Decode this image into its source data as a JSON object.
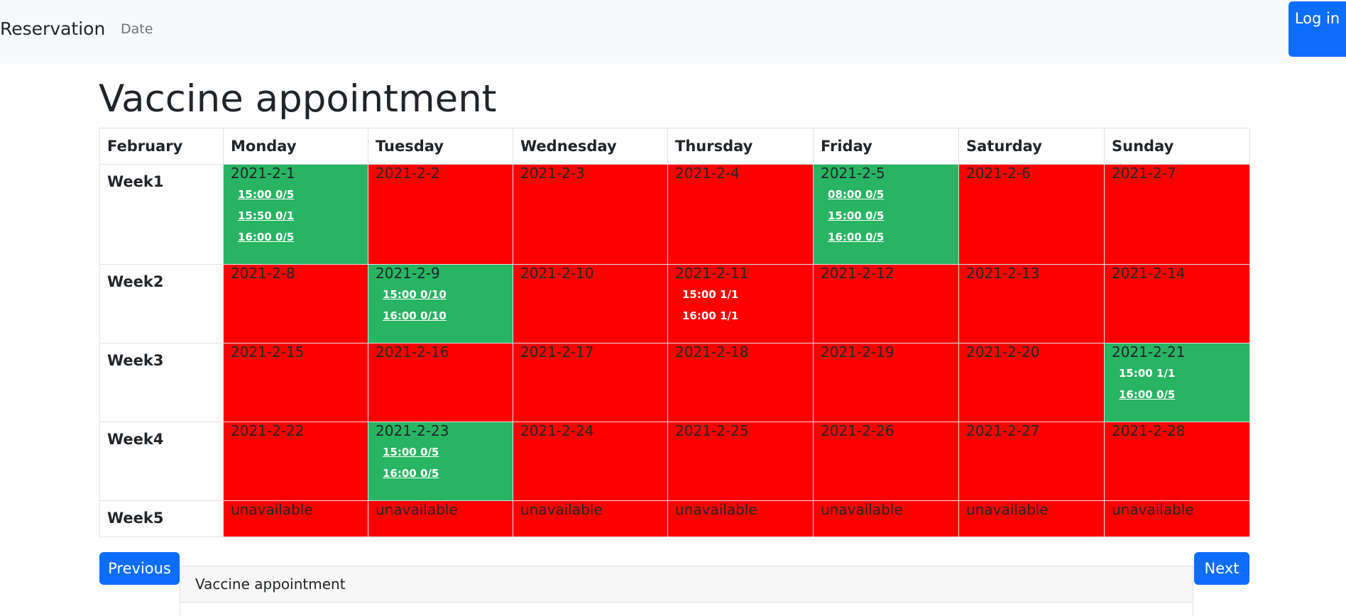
{
  "navbar": {
    "brand": "Reservation",
    "date_link": "Date",
    "login_button": "Log in"
  },
  "page": {
    "title": "Vaccine appointment"
  },
  "calendar": {
    "month": "February",
    "days": [
      "Monday",
      "Tuesday",
      "Wednesday",
      "Thursday",
      "Friday",
      "Saturday",
      "Sunday"
    ],
    "weeks": [
      {
        "label": "Week1",
        "cells": [
          {
            "date": "2021-2-1",
            "status": "available",
            "slots": [
              {
                "text": "15:00 0/5",
                "link": true
              },
              {
                "text": "15:50 0/1",
                "link": true
              },
              {
                "text": "16:00 0/5",
                "link": true
              }
            ]
          },
          {
            "date": "2021-2-2",
            "status": "unavailable",
            "slots": []
          },
          {
            "date": "2021-2-3",
            "status": "unavailable",
            "slots": []
          },
          {
            "date": "2021-2-4",
            "status": "unavailable",
            "slots": []
          },
          {
            "date": "2021-2-5",
            "status": "available",
            "slots": [
              {
                "text": "08:00 0/5",
                "link": true
              },
              {
                "text": "15:00 0/5",
                "link": true
              },
              {
                "text": "16:00 0/5",
                "link": true
              }
            ]
          },
          {
            "date": "2021-2-6",
            "status": "unavailable",
            "slots": []
          },
          {
            "date": "2021-2-7",
            "status": "unavailable",
            "slots": []
          }
        ]
      },
      {
        "label": "Week2",
        "cells": [
          {
            "date": "2021-2-8",
            "status": "unavailable",
            "slots": []
          },
          {
            "date": "2021-2-9",
            "status": "available",
            "slots": [
              {
                "text": "15:00 0/10",
                "link": true
              },
              {
                "text": "16:00 0/10",
                "link": true
              }
            ]
          },
          {
            "date": "2021-2-10",
            "status": "unavailable",
            "slots": []
          },
          {
            "date": "2021-2-11",
            "status": "unavailable",
            "slots": [
              {
                "text": "15:00 1/1",
                "link": false
              },
              {
                "text": "16:00 1/1",
                "link": false
              }
            ]
          },
          {
            "date": "2021-2-12",
            "status": "unavailable",
            "slots": []
          },
          {
            "date": "2021-2-13",
            "status": "unavailable",
            "slots": []
          },
          {
            "date": "2021-2-14",
            "status": "unavailable",
            "slots": []
          }
        ]
      },
      {
        "label": "Week3",
        "cells": [
          {
            "date": "2021-2-15",
            "status": "unavailable",
            "slots": []
          },
          {
            "date": "2021-2-16",
            "status": "unavailable",
            "slots": []
          },
          {
            "date": "2021-2-17",
            "status": "unavailable",
            "slots": []
          },
          {
            "date": "2021-2-18",
            "status": "unavailable",
            "slots": []
          },
          {
            "date": "2021-2-19",
            "status": "unavailable",
            "slots": []
          },
          {
            "date": "2021-2-20",
            "status": "unavailable",
            "slots": []
          },
          {
            "date": "2021-2-21",
            "status": "available",
            "slots": [
              {
                "text": "15:00 1/1",
                "link": false
              },
              {
                "text": "16:00 0/5",
                "link": true
              }
            ]
          }
        ]
      },
      {
        "label": "Week4",
        "cells": [
          {
            "date": "2021-2-22",
            "status": "unavailable",
            "slots": []
          },
          {
            "date": "2021-2-23",
            "status": "available",
            "slots": [
              {
                "text": "15:00 0/5",
                "link": true
              },
              {
                "text": "16:00 0/5",
                "link": true
              }
            ]
          },
          {
            "date": "2021-2-24",
            "status": "unavailable",
            "slots": []
          },
          {
            "date": "2021-2-25",
            "status": "unavailable",
            "slots": []
          },
          {
            "date": "2021-2-26",
            "status": "unavailable",
            "slots": []
          },
          {
            "date": "2021-2-27",
            "status": "unavailable",
            "slots": []
          },
          {
            "date": "2021-2-28",
            "status": "unavailable",
            "slots": []
          }
        ]
      },
      {
        "label": "Week5",
        "cells": [
          {
            "date": "unavailable",
            "status": "unavailable",
            "slots": []
          },
          {
            "date": "unavailable",
            "status": "unavailable",
            "slots": []
          },
          {
            "date": "unavailable",
            "status": "unavailable",
            "slots": []
          },
          {
            "date": "unavailable",
            "status": "unavailable",
            "slots": []
          },
          {
            "date": "unavailable",
            "status": "unavailable",
            "slots": []
          },
          {
            "date": "unavailable",
            "status": "unavailable",
            "slots": []
          },
          {
            "date": "unavailable",
            "status": "unavailable",
            "slots": []
          }
        ]
      }
    ]
  },
  "pagination": {
    "previous": "Previous",
    "next": "Next"
  },
  "card": {
    "header": "Vaccine appointment"
  },
  "colors": {
    "available": "#28b463",
    "unavailable": "#ff0000",
    "primary_button": "#0d6efd",
    "navbar_bg": "#f8f9fa"
  }
}
